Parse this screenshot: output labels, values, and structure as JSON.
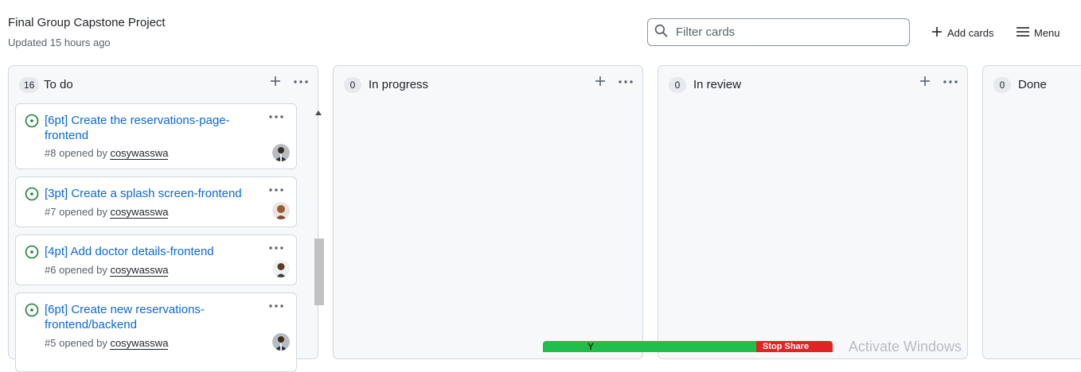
{
  "project": {
    "title": "Final Group Capstone Project",
    "updated": "Updated 15 hours ago"
  },
  "toolbar": {
    "search_placeholder": "Filter cards",
    "add_cards_label": "Add cards",
    "menu_label": "Menu"
  },
  "columns": [
    {
      "name": "To do",
      "count": "16",
      "cards": [
        {
          "title": "[6pt] Create the reservations-page-frontend",
          "number": "#8",
          "opened_by": "opened by",
          "user": "cosywasswa"
        },
        {
          "title": "[3pt] Create a splash screen-frontend",
          "number": "#7",
          "opened_by": "opened by",
          "user": "cosywasswa"
        },
        {
          "title": "[4pt] Add doctor details-frontend",
          "number": "#6",
          "opened_by": "opened by",
          "user": "cosywasswa"
        },
        {
          "title": "[6pt] Create new reservations-frontend/backend",
          "number": "#5",
          "opened_by": "opened by",
          "user": "cosywasswa"
        }
      ]
    },
    {
      "name": "In progress",
      "count": "0",
      "cards": []
    },
    {
      "name": "In review",
      "count": "0",
      "cards": []
    },
    {
      "name": "Done",
      "count": "0",
      "cards": []
    }
  ],
  "icons": {
    "search": "search-icon",
    "add": "plus-icon",
    "menu": "hamburger-icon",
    "more": "kebab-icon",
    "issue_open": "issue-opened-icon"
  },
  "colors": {
    "link": "#0969da",
    "issue_open": "#1a7f37",
    "column_bg": "#f6f8fa",
    "share_bar": "#1fbf4a",
    "stop_share": "#e02424"
  },
  "overlay": {
    "share_text": "Y",
    "stop_share_label": "Stop Share",
    "watermark": "Activate Windows"
  }
}
